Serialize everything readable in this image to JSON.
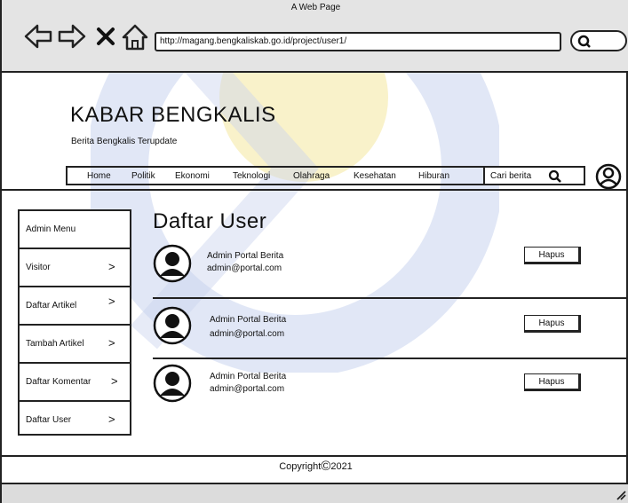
{
  "window": {
    "title": "A Web Page"
  },
  "browser": {
    "url": "http://magang.bengkaliskab.go.id/project/user1/",
    "icons": [
      "back-arrow-icon",
      "forward-arrow-icon",
      "close-x-icon",
      "home-icon",
      "search-icon"
    ]
  },
  "site": {
    "title": "KABAR BENGKALIS",
    "tagline": "Berita Bengkalis Terupdate"
  },
  "nav": {
    "items": [
      "Home",
      "Politik",
      "Ekonomi",
      "Teknologi",
      "Olahraga",
      "Kesehatan",
      "Hiburan"
    ],
    "search_label": "Cari berita",
    "search_icon": "search-icon",
    "profile_icon": "user-profile-icon"
  },
  "sidebar": {
    "header": "Admin Menu",
    "items": [
      {
        "label": "Visitor",
        "chevron": ">"
      },
      {
        "label": "Daftar Artikel",
        "chevron": ">"
      },
      {
        "label": "Tambah Artikel",
        "chevron": ">"
      },
      {
        "label": "Daftar Komentar",
        "chevron": ">"
      },
      {
        "label": "Daftar User",
        "chevron": ">"
      }
    ]
  },
  "main": {
    "title": "Daftar User",
    "users": [
      {
        "name": "Admin Portal Berita",
        "email": "admin@portal.com",
        "action": "Hapus"
      },
      {
        "name": "Admin Portal Berita",
        "email": "admin@portal.com",
        "action": "Hapus"
      },
      {
        "name": "Admin Portal Berita",
        "email": "admin@portal.com",
        "action": "Hapus"
      }
    ]
  },
  "footer": {
    "copyright": "Copyright",
    "symbol": "©",
    "year": "2021"
  },
  "colors": {
    "watermark_blue": "#c9d3ee",
    "watermark_yellow": "#f6ecb4",
    "chrome_gray": "#e4e4e4"
  }
}
